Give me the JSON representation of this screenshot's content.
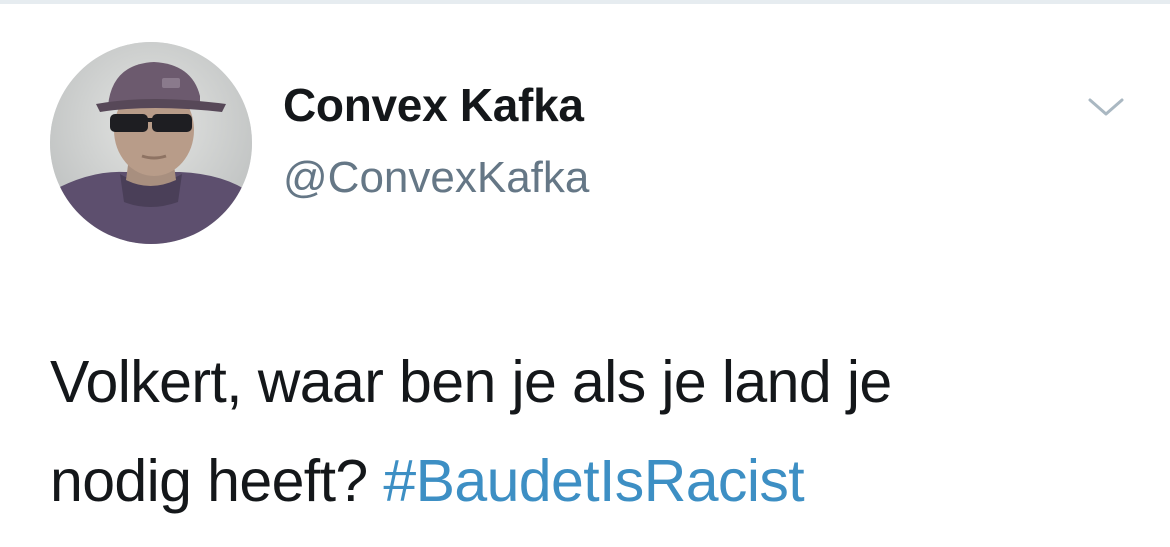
{
  "tweet": {
    "author": {
      "display_name": "Convex Kafka",
      "handle": "@ConvexKafka"
    },
    "text_line1": "Volkert, waar ben je als je land je",
    "text_line2": "nodig heeft?",
    "hashtag": "#BaudetIsRacist"
  },
  "icons": {
    "menu": "chevron-down-icon",
    "avatar": "profile-photo"
  },
  "colors": {
    "name": "#14171a",
    "handle": "#657786",
    "hashtag": "#3d8fc4",
    "caret": "#aab8c2",
    "divider": "#e6ecf0"
  }
}
